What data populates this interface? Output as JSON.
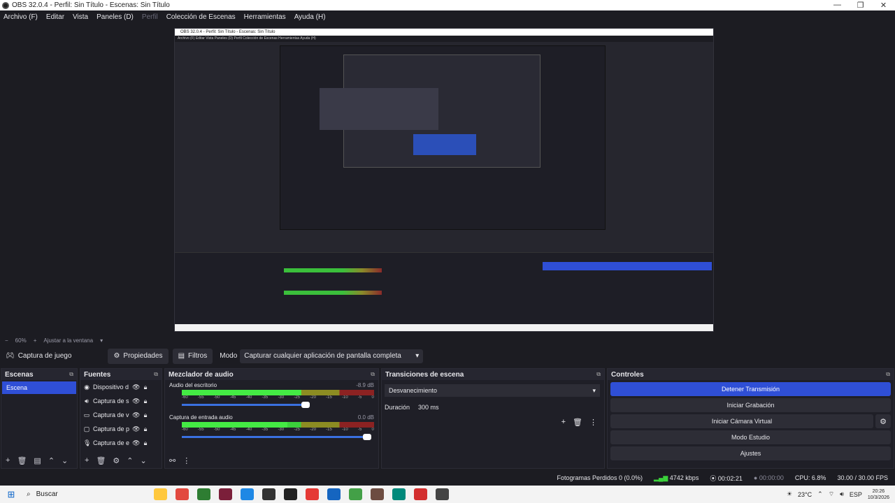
{
  "window": {
    "title": "OBS 32.0.4 - Perfil: Sin Título - Escenas: Sin Título",
    "controls": [
      "—",
      "❐",
      "✕"
    ]
  },
  "menu": {
    "items": [
      "Archivo (F)",
      "Editar",
      "Vista",
      "Paneles (D)",
      "Perfil",
      "Colección de Escenas",
      "Herramientas",
      "Ayuda (H)"
    ]
  },
  "preview": {
    "nested_title": "OBS 32.0.4 - Perfil: Sin Título - Escenas: Sin Título",
    "nested_menu": "Archivo (F)   Editar   Vista   Paneles (D)   Perfil   Colección de Escenas   Herramientas   Ayuda (H)"
  },
  "zoom": {
    "percent": "60%",
    "fit": "Ajustar a la ventana"
  },
  "source_toolbar": {
    "source_name": "Captura de juego",
    "properties": "Propiedades",
    "filters": "Filtros",
    "mode_label": "Modo",
    "mode_value": "Capturar cualquier aplicación de pantalla completa"
  },
  "scenes": {
    "title": "Escenas",
    "items": [
      "Escena"
    ]
  },
  "sources": {
    "title": "Fuentes",
    "items": [
      "Dispositivo d",
      "Captura de s",
      "Captura de v",
      "Captura de p",
      "Captura de e"
    ]
  },
  "mixer": {
    "title": "Mezclador de audio",
    "tracks": [
      {
        "name": "Audio del escritorio",
        "db": "-8.9 dB",
        "level": 0.62
      },
      {
        "name": "Captura de entrada audio",
        "db": "0.0 dB",
        "level": 0.55
      }
    ],
    "ticks": [
      "-60",
      "-55",
      "-50",
      "-45",
      "-40",
      "-35",
      "-30",
      "-25",
      "-20",
      "-15",
      "-10",
      "-5",
      "0"
    ]
  },
  "transitions": {
    "title": "Transiciones de escena",
    "selected": "Desvanecimiento",
    "duration_label": "Duración",
    "duration_value": "300 ms"
  },
  "controls": {
    "title": "Controles",
    "stop_stream": "Detener Transmisión",
    "start_recording": "Iniciar Grabación",
    "virtual_cam": "Iniciar Cámara Virtual",
    "studio_mode": "Modo Estudio",
    "settings": "Ajustes"
  },
  "status": {
    "dropped": "Fotogramas Perdidos 0 (0.0%)",
    "bitrate": "4742 kbps",
    "stream_time": "00:02:21",
    "rec_time": "00:00:00",
    "cpu": "CPU: 6.8%",
    "fps": "30.00 / 30.00 FPS"
  },
  "taskbar": {
    "search": "Buscar",
    "weather": "23°C",
    "lang": "ESP",
    "time": "20:26",
    "date": "10/3/2026"
  },
  "colors": {
    "accent": "#2f4fd6",
    "meter_green": "#3bd13b",
    "bg": "#1c1c22"
  }
}
